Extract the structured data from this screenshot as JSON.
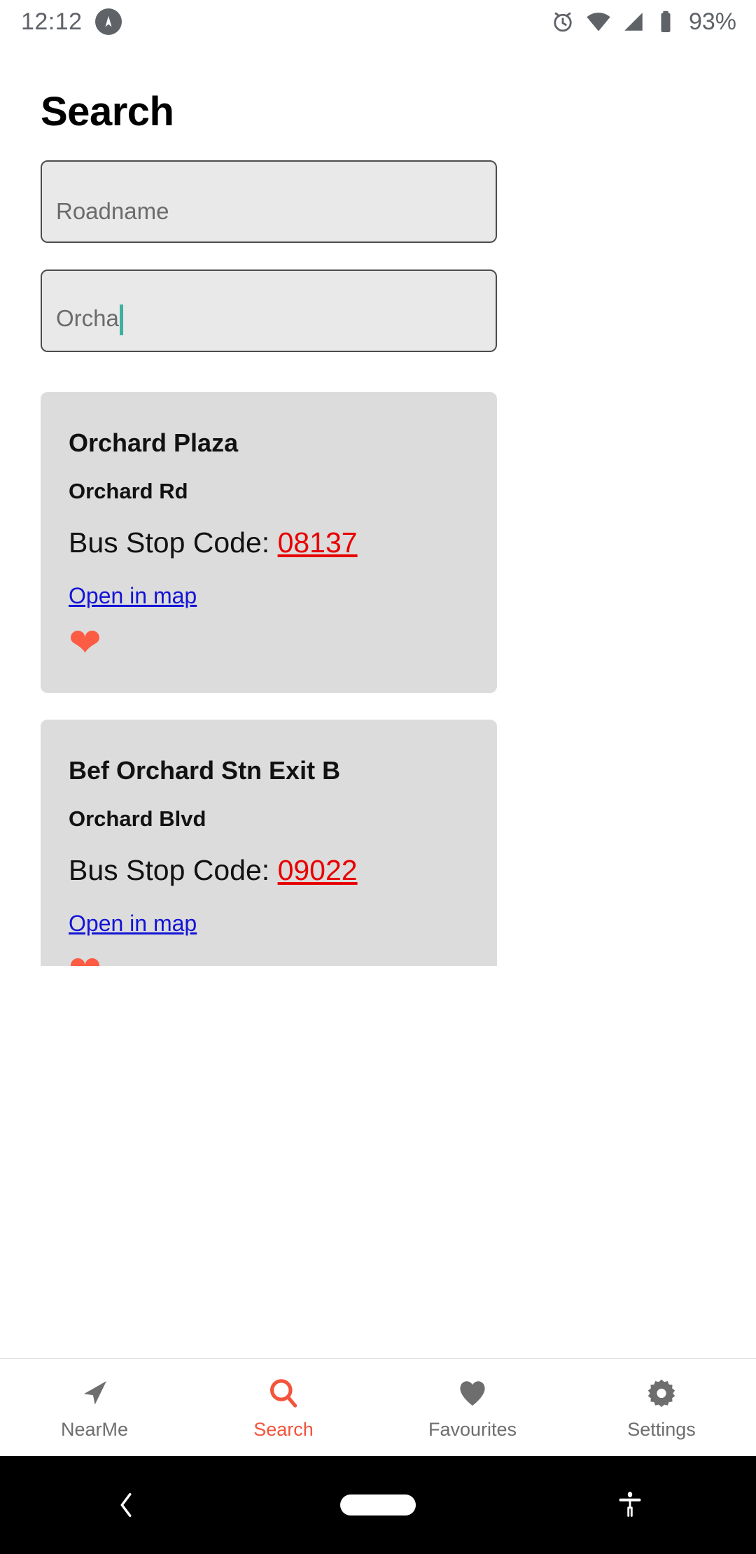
{
  "status_bar": {
    "time": "12:12",
    "app_icon": "compass-icon",
    "alarm_icon": "alarm-icon",
    "wifi_icon": "wifi-icon",
    "signal_icon": "signal-icon",
    "battery_icon": "battery-icon",
    "battery_percent": "93%"
  },
  "header": {
    "title": "Search"
  },
  "search_form": {
    "roadname_field": {
      "value": "",
      "placeholder": "Roadname"
    },
    "query_field": {
      "value": "Orcha",
      "placeholder": ""
    }
  },
  "results": [
    {
      "name": "Orchard Plaza",
      "road": "Orchard Rd",
      "code_label": "Bus Stop Code: ",
      "code": "08137",
      "map_link": "Open in map",
      "favourite_icon": "heart-icon",
      "favourite_color": "#fc5b44"
    },
    {
      "name": "Bef Orchard Stn Exit B",
      "road": "Orchard Blvd",
      "code_label": "Bus Stop Code: ",
      "code": "09022",
      "map_link": "Open in map",
      "favourite_icon": "heart-icon",
      "favourite_color": "#fc5b44"
    }
  ],
  "tab_bar": {
    "active": "Search",
    "active_color": "#f4543c",
    "inactive_color": "#6e6e6e",
    "items": [
      {
        "label": "NearMe",
        "icon": "navigation-arrow-icon"
      },
      {
        "label": "Search",
        "icon": "search-icon"
      },
      {
        "label": "Favourites",
        "icon": "heart-icon"
      },
      {
        "label": "Settings",
        "icon": "gear-icon"
      }
    ]
  },
  "android_nav": {
    "back_icon": "back-chevron-icon",
    "home_icon": "home-pill-icon",
    "accessibility_icon": "accessibility-icon"
  },
  "colors": {
    "code_red": "#e80000",
    "link_blue": "#1414d6",
    "caret_teal": "#3fb0a0",
    "card_bg": "#dcdcdc",
    "field_bg": "#e9e9e9"
  }
}
